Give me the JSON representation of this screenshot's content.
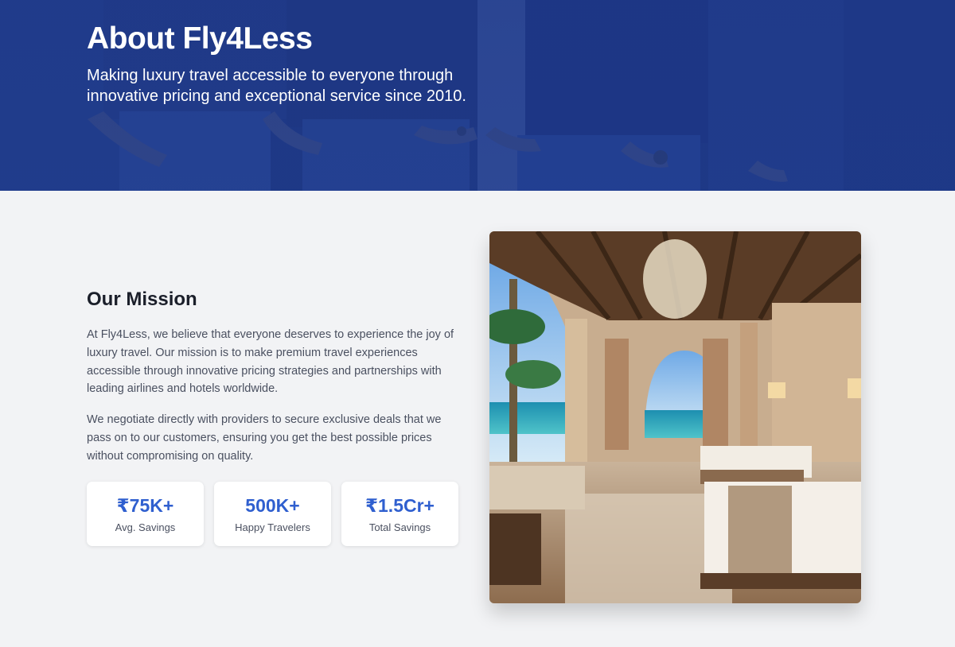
{
  "hero": {
    "title": "About Fly4Less",
    "subtitle": "Making luxury travel accessible to everyone through innovative pricing and exceptional service since 2010."
  },
  "mission": {
    "title": "Our Mission",
    "paragraphs": [
      "At Fly4Less, we believe that everyone deserves to experience the joy of luxury travel. Our mission is to make premium travel experiences accessible through innovative pricing strategies and partnerships with leading airlines and hotels worldwide.",
      "We negotiate directly with providers to secure exclusive deals that we pass on to our customers, ensuring you get the best possible prices without compromising on quality."
    ]
  },
  "stats": [
    {
      "value": "₹75K+",
      "label": "Avg. Savings"
    },
    {
      "value": "500K+",
      "label": "Happy Travelers"
    },
    {
      "value": "₹1.5Cr+",
      "label": "Total Savings"
    }
  ],
  "colors": {
    "hero_bg": "#1f3c88",
    "accent": "#2f5fcf",
    "page_bg": "#f2f3f5",
    "heading": "#1b1f2a",
    "body_text": "#4a5060"
  }
}
